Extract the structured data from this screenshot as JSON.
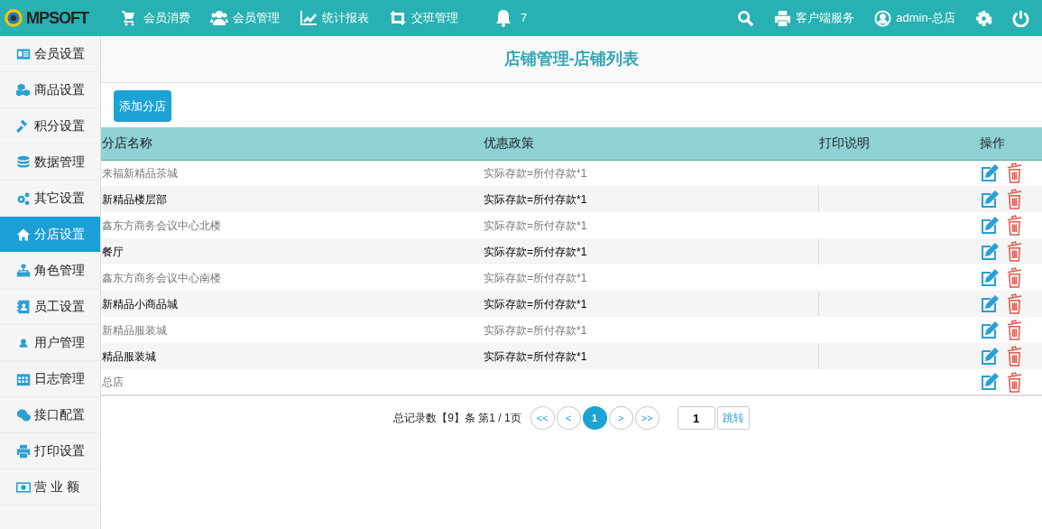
{
  "topbar": {
    "logo": "MPSOFT",
    "nav": [
      {
        "label": "会员消费"
      },
      {
        "label": "会员管理"
      },
      {
        "label": "统计报表"
      },
      {
        "label": "交班管理"
      }
    ],
    "notifications": "7",
    "right": [
      {
        "kind": "search"
      },
      {
        "kind": "print",
        "label": "客户端服务"
      },
      {
        "kind": "user",
        "label": "admin-总店"
      },
      {
        "kind": "settings"
      },
      {
        "kind": "power"
      }
    ]
  },
  "sidebar": {
    "items": [
      {
        "label": "会员设置",
        "selected": false
      },
      {
        "label": "商品设置",
        "selected": false
      },
      {
        "label": "积分设置",
        "selected": false
      },
      {
        "label": "数据管理",
        "selected": false
      },
      {
        "label": "其它设置",
        "selected": false
      },
      {
        "label": "分店设置",
        "selected": true
      },
      {
        "label": "角色管理",
        "selected": false
      },
      {
        "label": "员工设置",
        "selected": false
      },
      {
        "label": "用户管理",
        "selected": false
      },
      {
        "label": "日志管理",
        "selected": false
      },
      {
        "label": "接口配置",
        "selected": false
      },
      {
        "label": "打印设置",
        "selected": false
      },
      {
        "label": "营 业 额",
        "selected": false
      }
    ]
  },
  "page_title": "店铺管理-店铺列表",
  "add_button": "添加分店",
  "table": {
    "columns": [
      "分店名称",
      "优惠政策",
      "打印说明",
      "操作"
    ],
    "rows": [
      {
        "name": "来福新精品茶城",
        "policy": "实际存款=所付存款*1"
      },
      {
        "name": "新精品楼层部",
        "policy": "实际存款=所付存款*1"
      },
      {
        "name": "鑫东方商务会议中心北楼",
        "policy": "实际存款=所付存款*1"
      },
      {
        "name": "餐厅",
        "policy": "实际存款=所付存款*1"
      },
      {
        "name": "鑫东方商务会议中心南楼",
        "policy": "实际存款=所付存款*1"
      },
      {
        "name": "新精品小商品城",
        "policy": "实际存款=所付存款*1"
      },
      {
        "name": "新精品服装城",
        "policy": "实际存款=所付存款*1"
      },
      {
        "name": "精品服装城",
        "policy": "实际存款=所付存款*1"
      },
      {
        "name": "总店"
      }
    ]
  },
  "pagination": {
    "summary": "总记录数【9】条 第1 / 1页",
    "buttons": [
      {
        "label": "<<",
        "selected": false
      },
      {
        "label": "<",
        "selected": false
      },
      {
        "label": "1",
        "selected": true
      },
      {
        "label": ">",
        "selected": false
      },
      {
        "label": ">>",
        "selected": false
      }
    ],
    "page_input": "1",
    "jump": "跳转"
  }
}
